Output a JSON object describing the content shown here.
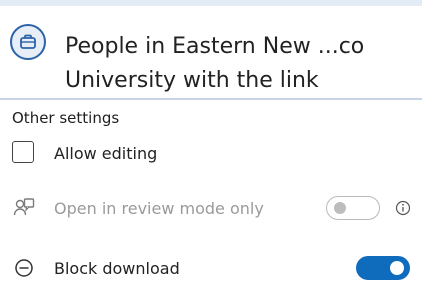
{
  "header": {
    "title_line1": "People in Eastern New ...co",
    "title_line2": "University with the link",
    "icon": "briefcase-icon"
  },
  "settings": {
    "section_title": "Other settings",
    "allow_editing": {
      "label": "Allow editing",
      "checked": false
    },
    "review_mode": {
      "label": "Open in review mode only",
      "enabled": false,
      "toggle_on": false,
      "icon": "review-icon",
      "info_icon": "info-icon"
    },
    "block_download": {
      "label": "Block download",
      "toggle_on": true,
      "icon": "block-icon"
    }
  },
  "colors": {
    "accent": "#0f6cbd",
    "header_strip": "#e3ebf6",
    "divider": "#c7d3e6",
    "disabled_text": "#9a9a9a"
  }
}
